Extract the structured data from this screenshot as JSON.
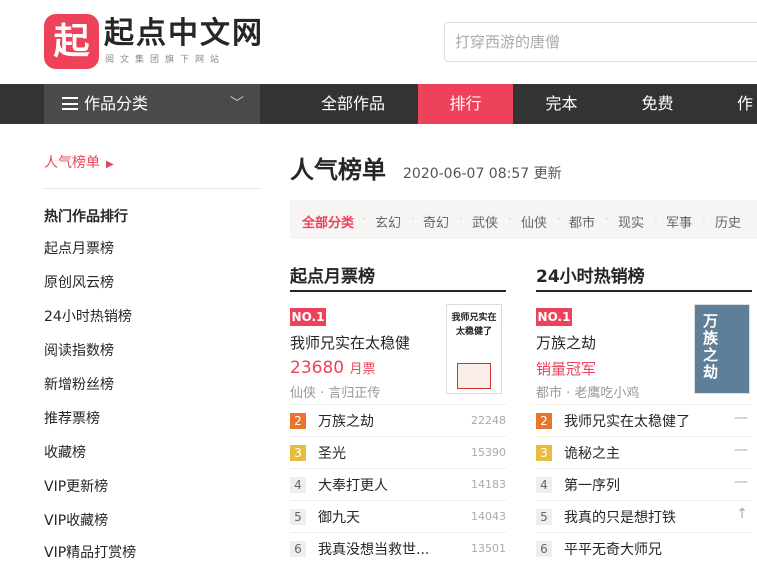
{
  "header": {
    "logo_mark": "起",
    "logo_text": "起点中文网",
    "logo_sub": "阅文集团旗下网站",
    "search_placeholder": "打穿西游的唐僧"
  },
  "nav": {
    "category": "作品分类",
    "links": [
      "全部作品",
      "排行",
      "完本",
      "免费",
      "作"
    ]
  },
  "sidebar": {
    "hot": "人气榜单",
    "title": "热门作品排行",
    "items": [
      "起点月票榜",
      "原创风云榜",
      "24小时热销榜",
      "阅读指数榜",
      "新增粉丝榜",
      "推荐票榜",
      "收藏榜",
      "VIP更新榜",
      "VIP收藏榜",
      "VIP精品打赏榜"
    ]
  },
  "main": {
    "title": "人气榜单",
    "date": "2020-06-07 08:57 更新",
    "filters": [
      "全部分类",
      "玄幻",
      "奇幻",
      "武侠",
      "仙侠",
      "都市",
      "现实",
      "军事",
      "历史"
    ]
  },
  "ranking_left": {
    "title": "起点月票榜",
    "top": {
      "badge": "NO.1",
      "name": "我师兄实在太稳健",
      "count": "23680",
      "unit": "月票",
      "meta": "仙侠 · 言归正传",
      "cover_text": "我师兄实在太稳健了"
    },
    "rows": [
      {
        "rank": "2",
        "name": "万族之劫",
        "value": "22248"
      },
      {
        "rank": "3",
        "name": "圣光",
        "value": "15390"
      },
      {
        "rank": "4",
        "name": "大奉打更人",
        "value": "14183"
      },
      {
        "rank": "5",
        "name": "御九天",
        "value": "14043"
      },
      {
        "rank": "6",
        "name": "我真没想当救世...",
        "value": "13501"
      }
    ]
  },
  "ranking_right": {
    "title": "24小时热销榜",
    "top": {
      "badge": "NO.1",
      "name": "万族之劫",
      "tag": "销量冠军",
      "meta": "都市 · 老鹰吃小鸡",
      "cover_text": "万族之劫"
    },
    "rows": [
      {
        "rank": "2",
        "name": "我师兄实在太稳健了",
        "value": "—"
      },
      {
        "rank": "3",
        "name": "诡秘之主",
        "value": "—"
      },
      {
        "rank": "4",
        "name": "第一序列",
        "value": "—"
      },
      {
        "rank": "5",
        "name": "我真的只是想打铁",
        "value": "↑"
      },
      {
        "rank": "6",
        "name": "平平无奇大师兄",
        "value": ""
      }
    ]
  }
}
